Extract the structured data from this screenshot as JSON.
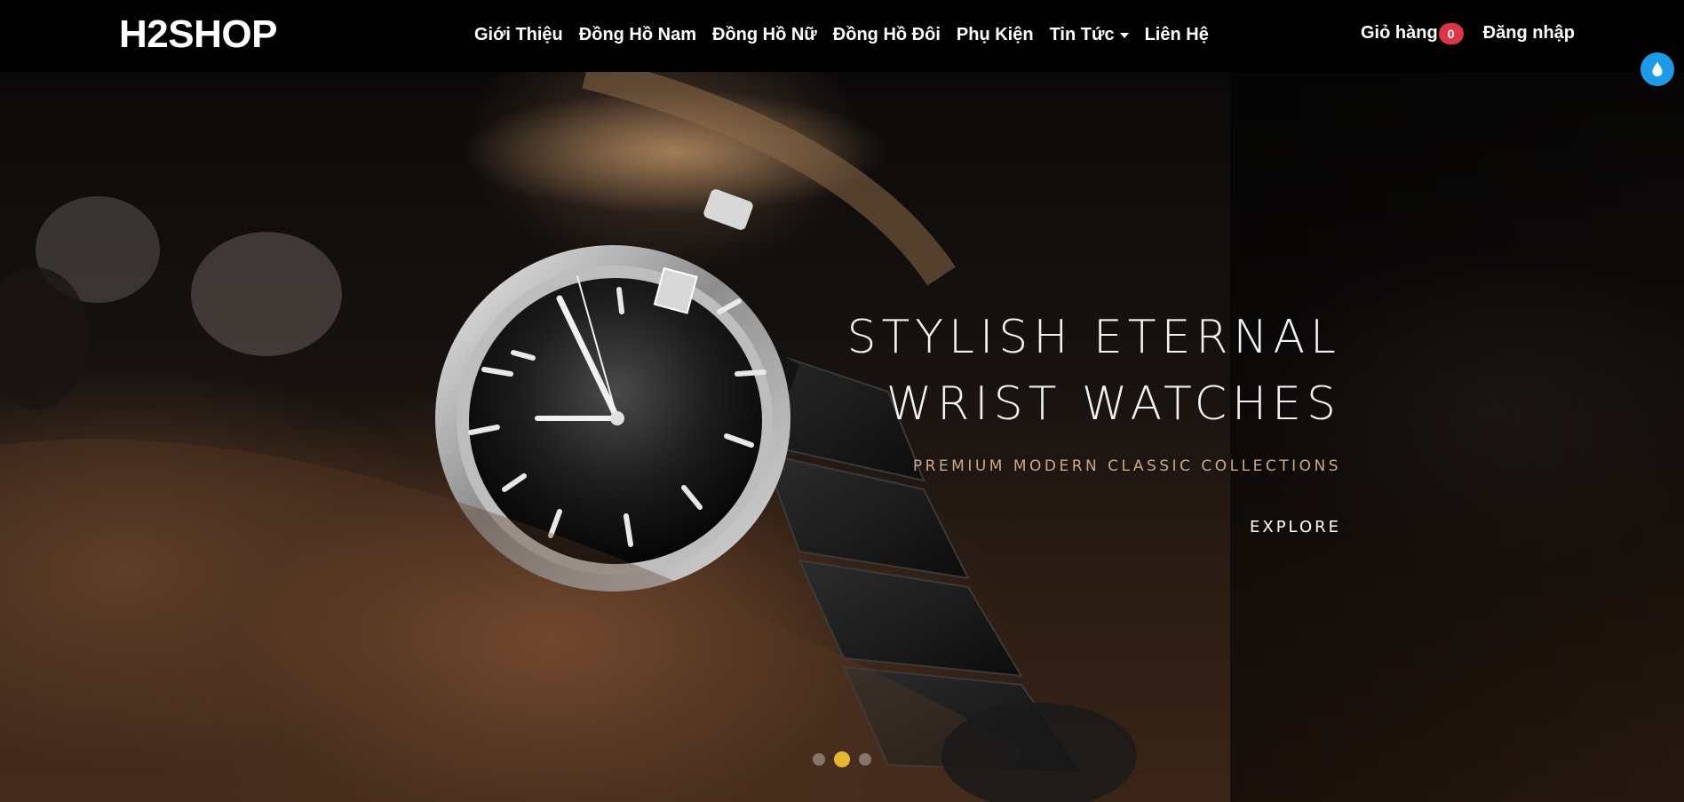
{
  "navbar": {
    "brand": "H2SHOP",
    "links": [
      {
        "label": "Giới Thiệu"
      },
      {
        "label": "Đồng Hồ Nam"
      },
      {
        "label": "Đồng Hồ Nữ"
      },
      {
        "label": "Đồng Hồ Đôi"
      },
      {
        "label": "Phụ Kiện"
      },
      {
        "label": "Tin Tức",
        "dropdown": true
      },
      {
        "label": "Liên Hệ"
      }
    ],
    "cart": {
      "label": "Giỏ hàng",
      "count": "0"
    },
    "login": "Đăng nhập"
  },
  "theme_button": {
    "icon": "water-drop-icon",
    "color": "#1e9be8"
  },
  "hero": {
    "title_line1": "STYLISH ETERNAL",
    "title_line2": "WRIST WATCHES",
    "subtitle": "PREMIUM MODERN CLASSIC COLLECTIONS",
    "cta": "EXPLORE",
    "slides_total": 3,
    "active_slide": 2
  },
  "colors": {
    "nav_bg": "#000000",
    "badge": "#dc3545",
    "subtitle": "#c9a98a",
    "active_indicator": "#e5b92f"
  }
}
